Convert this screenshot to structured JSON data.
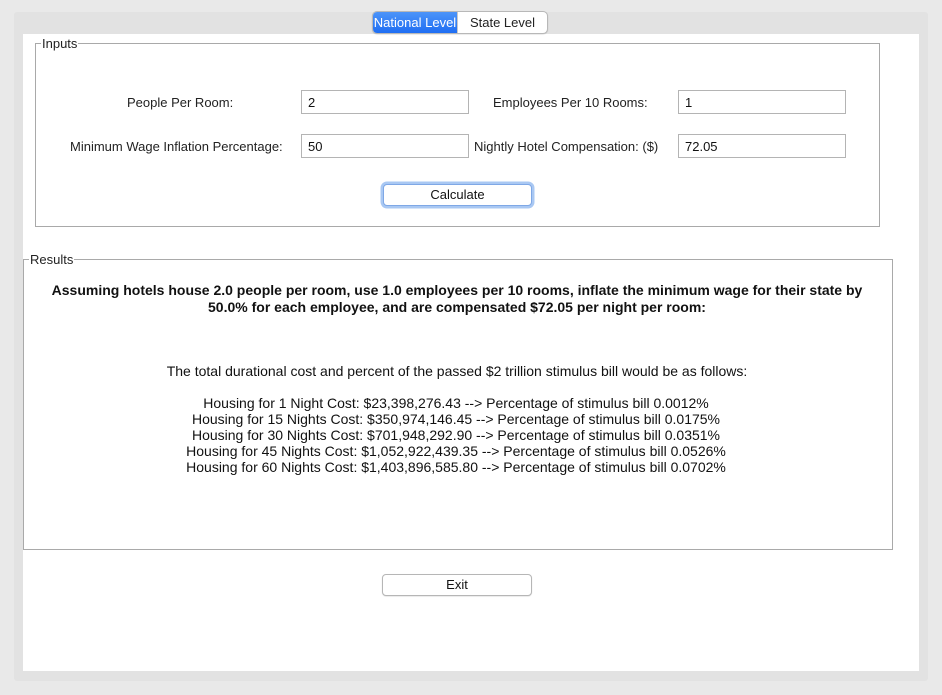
{
  "tabs": [
    {
      "label": "National Level",
      "active": true
    },
    {
      "label": "State Level",
      "active": false
    }
  ],
  "inputs": {
    "legend": "Inputs",
    "people_per_room": {
      "label": "People Per Room:",
      "value": "2"
    },
    "employees_per_10_rooms": {
      "label": "Employees Per 10 Rooms:",
      "value": "1"
    },
    "min_wage_inflation": {
      "label": "Minimum Wage Inflation Percentage:",
      "value": "50"
    },
    "nightly_compensation": {
      "label": "Nightly Hotel Compensation: ($)",
      "value": "72.05"
    },
    "calculate_label": "Calculate"
  },
  "results": {
    "legend": "Results",
    "summary": "Assuming hotels house 2.0 people per room, use 1.0 employees per 10 rooms, inflate the minimum wage for their state by 50.0% for each employee, and are compensated $72.05 per night per room:",
    "intro": "The total durational cost and percent of the passed $2 trillion stimulus bill would be as follows:",
    "lines": [
      "Housing for 1 Night Cost: $23,398,276.43 --> Percentage of stimulus bill 0.0012%",
      "Housing for 15 Nights Cost: $350,974,146.45 --> Percentage of stimulus bill 0.0175%",
      "Housing for 30 Nights Cost: $701,948,292.90 --> Percentage of stimulus bill 0.0351%",
      "Housing for 45 Nights Cost: $1,052,922,439.35 --> Percentage of stimulus bill 0.0526%",
      "Housing for 60 Nights Cost: $1,403,896,585.80 --> Percentage of stimulus bill 0.0702%"
    ]
  },
  "exit_label": "Exit",
  "colors": {
    "accent": "#1f6ef3",
    "focus_ring": "#a9c8f3",
    "panel": "#ffffff",
    "window": "#e9e9e9"
  }
}
